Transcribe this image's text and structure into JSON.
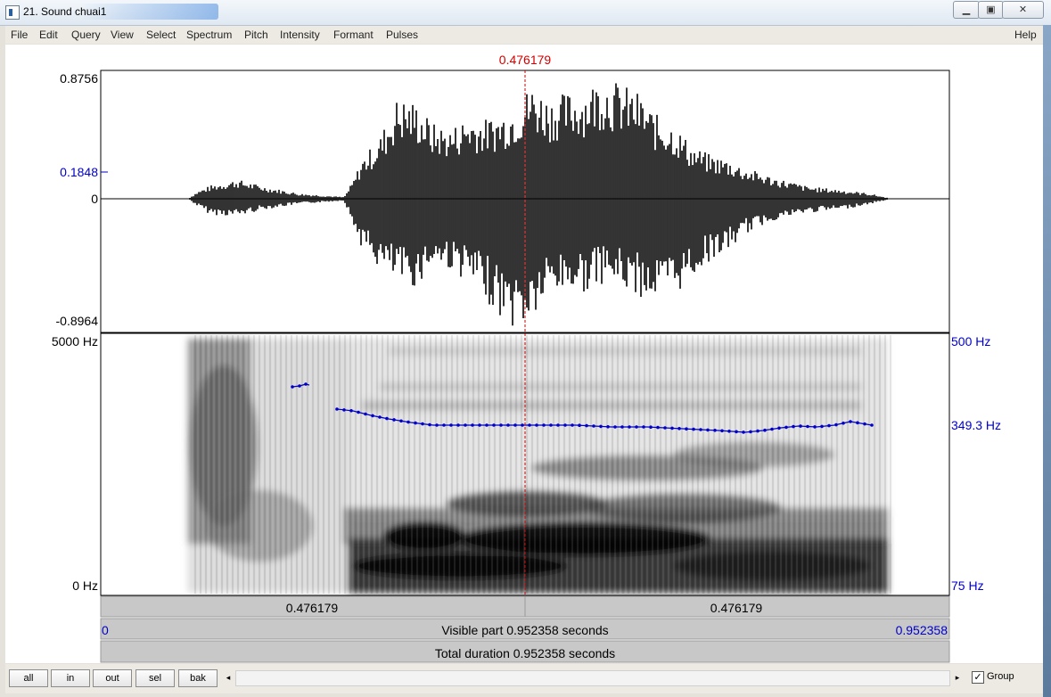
{
  "window": {
    "title": "21. Sound chuai1",
    "minimize_icon": "minimize-icon",
    "maximize_icon": "maximize-icon",
    "close_icon": "close-icon"
  },
  "menu": {
    "items": [
      "File",
      "Edit",
      "Query",
      "View",
      "Select",
      "Spectrum",
      "Pitch",
      "Intensity",
      "Formant",
      "Pulses"
    ],
    "help": "Help"
  },
  "cursor": {
    "time_label": "0.476179"
  },
  "waveform": {
    "y_max": "0.8756",
    "y_cursor": "0.1848",
    "y_zero": "0",
    "y_min": "-0.8964"
  },
  "spectrogram": {
    "freq_top": "5000 Hz",
    "freq_bottom": "0 Hz",
    "pitch_top": "500 Hz",
    "pitch_value": "349.3 Hz",
    "pitch_bottom": "75 Hz"
  },
  "time_bars": {
    "left_segment": "0.476179",
    "right_segment": "0.476179",
    "visible_start": "0",
    "visible_end": "0.952358",
    "visible_label": "Visible part 0.952358 seconds",
    "total_label": "Total duration 0.952358 seconds"
  },
  "buttons": {
    "all": "all",
    "in": "in",
    "out": "out",
    "sel": "sel",
    "bak": "bak",
    "scroll_left": "◂",
    "scroll_right": "▸"
  },
  "group": {
    "label": "Group",
    "checked_mark": "✓"
  },
  "colors": {
    "cursor": "#d00000",
    "pitch": "#0000c8",
    "axis_blue": "#0000c8"
  }
}
